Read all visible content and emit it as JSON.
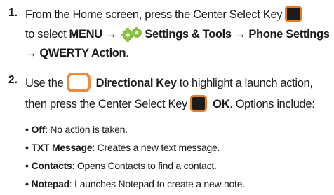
{
  "colors": {
    "key_border": "#ee7a1c",
    "key_fill": "#1c1c1c",
    "text": "#1a1a1a"
  },
  "icons": [
    "center-select-key-icon",
    "settings-tools-gear-icon",
    "directional-key-icon"
  ],
  "step1": {
    "number": "1.",
    "line1_text": "From the Home screen, press the Center Select Key",
    "line2_pre": "to select ",
    "menu": "MENU",
    "arrow1": " → ",
    "settings_tools": "Settings & Tools",
    "arrow2": " → ",
    "phone_settings": "Phone Settings",
    "line3_arrow": "→ ",
    "qwerty_action": "QWERTY Action",
    "line3_end": "."
  },
  "step2": {
    "number": "2.",
    "line1_pre": "Use the ",
    "directional_key": "Directional Key",
    "line1_post": " to highlight a launch action,",
    "line2_pre": "then press the Center Select Key ",
    "ok": "OK",
    "line2_post": ". Options include:"
  },
  "options": [
    {
      "name": "Off",
      "desc": ": No action is taken."
    },
    {
      "name": "TXT Message",
      "desc": ": Creates a new text message."
    },
    {
      "name": "Contacts",
      "desc": ": Opens Contacts to find a contact."
    },
    {
      "name": "Notepad",
      "desc": ": Launches Notepad to create a new note."
    }
  ],
  "bullet_char": "•"
}
